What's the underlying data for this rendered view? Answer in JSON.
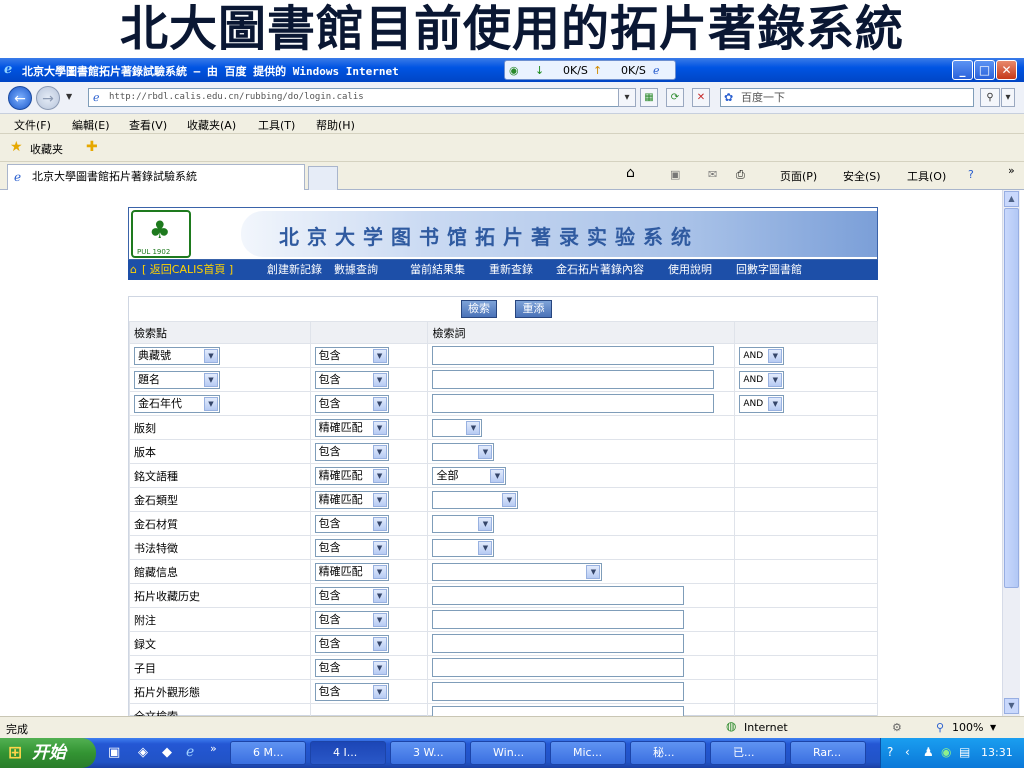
{
  "slide_title": "北大圖書館目前使用的拓片著錄系統",
  "window": {
    "title": "北京大學圖書館拓片著錄試驗系統 – 由 百度 提供的 Windows Internet",
    "speed_down": "0K/S",
    "speed_up": "0K/S"
  },
  "address": {
    "url": "http://rbdl.calis.edu.cn/rubbing/do/login.calis",
    "search_placeholder": "百度一下"
  },
  "menu": [
    "文件(F)",
    "編輯(E)",
    "查看(V)",
    "收藏夹(A)",
    "工具(T)",
    "帮助(H)"
  ],
  "favorites": {
    "label": "收藏夹"
  },
  "tab": {
    "title": "北京大學圖書館拓片著錄試驗系統",
    "tools": [
      "页面(P)",
      "安全(S)",
      "工具(O)"
    ]
  },
  "banner": {
    "title": "北京大学图书馆拓片著录实验系统",
    "logo_text": "PUL 1902"
  },
  "nav_links": [
    "[ 返回CALIS首頁 ]",
    "創建新記錄",
    "數據查詢",
    "當前結果集",
    "重新查錄",
    "金石拓片著錄內容",
    "使用說明",
    "回數字圖書館"
  ],
  "form": {
    "search_button": "檢索",
    "reset_button": "重添",
    "header": {
      "field": "檢索點",
      "term": "檢索詞"
    },
    "top_rows": [
      {
        "field": "典藏號",
        "match": "包含",
        "logic": "AND"
      },
      {
        "field": "題名",
        "match": "包含",
        "logic": "AND"
      },
      {
        "field": "金石年代",
        "match": "包含",
        "logic": "AND"
      }
    ],
    "rows": [
      {
        "label": "版刻",
        "match": "精確匹配",
        "value": ""
      },
      {
        "label": "版本",
        "match": "包含",
        "value": ""
      },
      {
        "label": "銘文語種",
        "match": "精確匹配",
        "value": "全部"
      },
      {
        "label": "金石類型",
        "match": "精確匹配",
        "value": ""
      },
      {
        "label": "金石材質",
        "match": "包含",
        "value": ""
      },
      {
        "label": "书法特徵",
        "match": "包含",
        "value": ""
      },
      {
        "label": "館藏信息",
        "match": "精確匹配",
        "value": ""
      },
      {
        "label": "拓片收藏历史",
        "match": "包含",
        "value": ""
      },
      {
        "label": "附注",
        "match": "包含",
        "value": ""
      },
      {
        "label": "録文",
        "match": "包含",
        "value": ""
      },
      {
        "label": "子目",
        "match": "包含",
        "value": ""
      },
      {
        "label": "拓片外觀形態",
        "match": "包含",
        "value": ""
      },
      {
        "label": "全文檢索",
        "match": "",
        "value": ""
      }
    ]
  },
  "status": {
    "text": "完成",
    "zone": "Internet",
    "zoom": "100%"
  },
  "taskbar": {
    "start": "开始",
    "tasks": [
      "6 M...",
      "4 I...",
      "3 W...",
      "Win...",
      "Mic...",
      "秘...",
      "已...",
      "Rar..."
    ],
    "time": "13:31"
  }
}
